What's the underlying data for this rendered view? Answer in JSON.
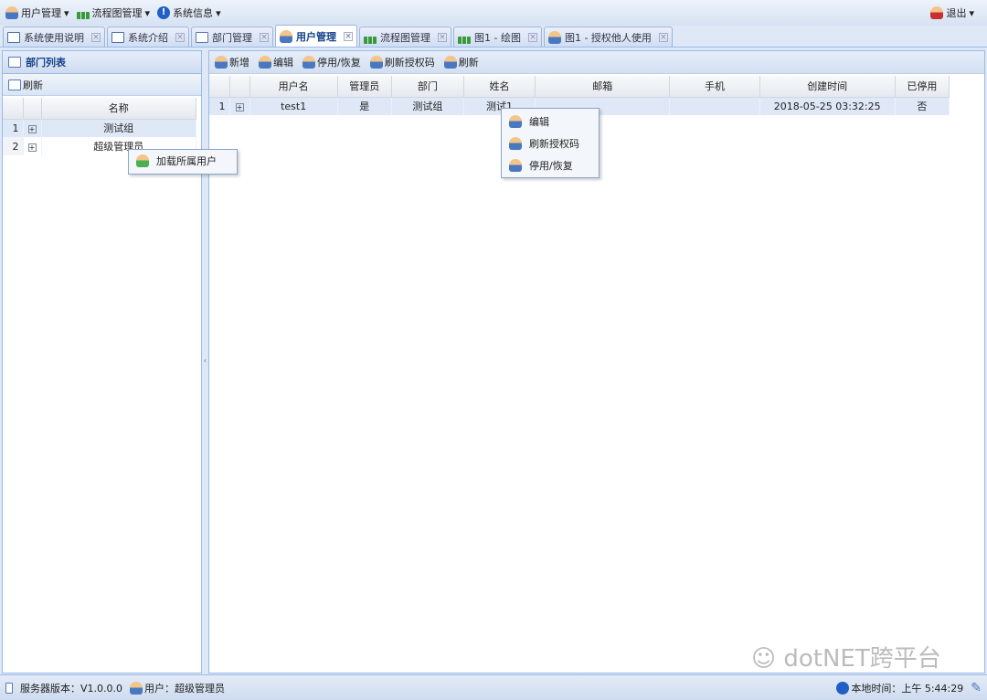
{
  "menu": [
    {
      "label": "用户管理",
      "icon": "user-icon"
    },
    {
      "label": "流程图管理",
      "icon": "flowchart-icon"
    },
    {
      "label": "系统信息",
      "icon": "info-icon"
    }
  ],
  "logout": "退出",
  "tabs": [
    {
      "label": "系统使用说明",
      "icon": "book-icon"
    },
    {
      "label": "系统介绍",
      "icon": "book-icon"
    },
    {
      "label": "部门管理",
      "icon": "window-icon"
    },
    {
      "label": "用户管理",
      "icon": "user-icon",
      "active": true
    },
    {
      "label": "流程图管理",
      "icon": "flowchart-icon"
    },
    {
      "label": "图1 - 绘图",
      "icon": "flowchart-icon"
    },
    {
      "label": "图1 - 授权他人使用",
      "icon": "user-key-icon"
    }
  ],
  "left": {
    "title": "部门列表",
    "refresh": "刷新",
    "column": "名称",
    "rows": [
      {
        "n": "1",
        "name": "测试组"
      },
      {
        "n": "2",
        "name": "超级管理员"
      }
    ],
    "context_menu": [
      "加载所属用户"
    ]
  },
  "right": {
    "toolbar": [
      "新增",
      "编辑",
      "停用/恢复",
      "刷新授权码",
      "刷新"
    ],
    "columns": [
      "用户名",
      "管理员",
      "部门",
      "姓名",
      "邮箱",
      "手机",
      "创建时间",
      "已停用"
    ],
    "rows": [
      {
        "n": "1",
        "cells": [
          "test1",
          "是",
          "测试组",
          "测试1",
          "",
          "",
          "2018-05-25 03:32:25",
          "否"
        ]
      }
    ],
    "context_menu": [
      "编辑",
      "刷新授权码",
      "停用/恢复"
    ]
  },
  "status": {
    "version": "服务器版本：V1.0.0.0",
    "user": "用户：超级管理员",
    "time": "本地时间：上午 5:44:29"
  },
  "watermark": "dotNET跨平台"
}
